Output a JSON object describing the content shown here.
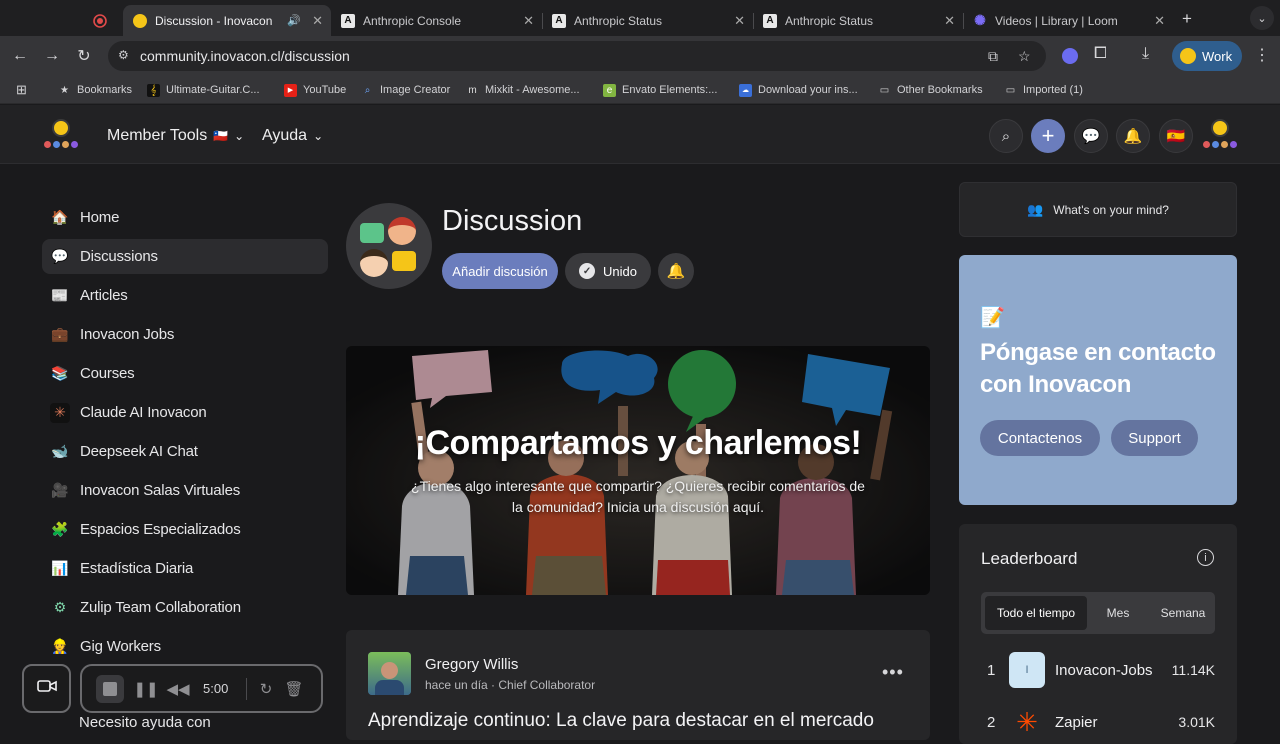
{
  "browser": {
    "tabs": [
      {
        "title": "",
        "icon": "record-icon"
      },
      {
        "title": "Discussion - Inovacon",
        "active": true
      },
      {
        "title": "Anthropic Console"
      },
      {
        "title": "Anthropic Status"
      },
      {
        "title": "Anthropic Status"
      },
      {
        "title": "Videos | Library | Loom"
      }
    ],
    "url": "community.inovacon.cl/discussion",
    "profile_label": "Work",
    "bookmarks": [
      {
        "label": "Bookmarks"
      },
      {
        "label": "Ultimate-Guitar.C..."
      },
      {
        "label": "YouTube"
      },
      {
        "label": "Image Creator"
      },
      {
        "label": "Mixkit - Awesome..."
      },
      {
        "label": "Envato Elements:..."
      },
      {
        "label": "Download your ins..."
      },
      {
        "label": "Other Bookmarks"
      },
      {
        "label": "Imported (1)"
      }
    ]
  },
  "header": {
    "member_tools": "Member Tools",
    "ayuda": "Ayuda",
    "flag": "🇪🇸"
  },
  "sidebar": {
    "items": [
      {
        "label": "Home",
        "icon": "🏠"
      },
      {
        "label": "Discussions",
        "icon": "💬",
        "active": true
      },
      {
        "label": "Articles",
        "icon": "📰"
      },
      {
        "label": "Inovacon Jobs",
        "icon": "💼"
      },
      {
        "label": "Courses",
        "icon": "📚"
      },
      {
        "label": "Claude AI Inovacon",
        "icon": "✳"
      },
      {
        "label": "Deepseek AI Chat",
        "icon": "🐋"
      },
      {
        "label": "Inovacon Salas Virtuales",
        "icon": "🎥"
      },
      {
        "label": "Espacios Especializados",
        "icon": "🧩"
      },
      {
        "label": "Estadística Diaria",
        "icon": "📊"
      },
      {
        "label": "Zulip Team Collaboration",
        "icon": "⚙"
      },
      {
        "label": "Gig Workers",
        "icon": "👷"
      }
    ],
    "peek_label": "Necesito ayuda con"
  },
  "discussion": {
    "title": "Discussion",
    "add_button": "Añadir discusión",
    "joined_button": "Unido"
  },
  "banner": {
    "title": "¡Compartamos y charlemos!",
    "subtitle": "¿Tienes algo interesante que compartir? ¿Quieres recibir comentarios de la comunidad? Inicia una discusión aquí."
  },
  "post": {
    "author": "Gregory Willis",
    "meta": "hace un día · Chief Collaborator",
    "title": "Aprendizaje continuo: La clave para destacar en el mercado"
  },
  "mind": {
    "label": "What's on your mind?"
  },
  "contact": {
    "title": "Póngase en contacto con Inovacon",
    "buttons": [
      "Contactenos",
      "Support"
    ]
  },
  "leaderboard": {
    "title": "Leaderboard",
    "tabs": [
      "Todo el tiempo",
      "Mes",
      "Semana"
    ],
    "rows": [
      {
        "rank": "1",
        "name": "Inovacon-Jobs",
        "points": "11.14K",
        "avatar": "I"
      },
      {
        "rank": "2",
        "name": "Zapier",
        "points": "3.01K",
        "avatar": ""
      }
    ]
  },
  "recorder": {
    "time": "5:00"
  },
  "colors": {
    "accent": "#6b7dbd",
    "contact_bg": "#8fa9cc",
    "contact_button": "#64749f"
  }
}
